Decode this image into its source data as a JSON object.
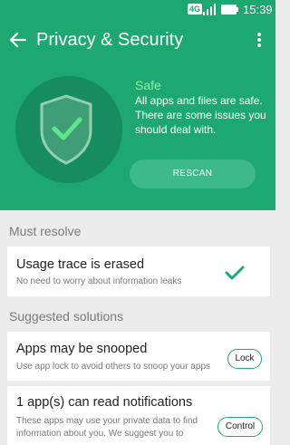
{
  "status_bar": {
    "network": "4G",
    "time": "15:39"
  },
  "app_bar": {
    "title": "Privacy & Security"
  },
  "status": {
    "label": "Safe",
    "description": "All apps and files are safe. There are some issues you should deal with."
  },
  "rescan_label": "RESCAN",
  "must_resolve": {
    "title": "Must resolve",
    "items": [
      {
        "title": "Usage trace is erased",
        "description": "No need to worry about information leaks"
      }
    ]
  },
  "suggested": {
    "title": "Suggested solutions",
    "items": [
      {
        "title": "Apps may be snooped",
        "description": "Use app lock to avoid others to snoop your apps",
        "action": "Lock"
      },
      {
        "title": "1 app(s) can read notifications",
        "description": "These apps may use your private data to find information about you. We suggest you to",
        "action": "Control"
      }
    ]
  },
  "colors": {
    "accent": "#1da771",
    "accent_dark": "#178c5e",
    "button": "#3db98a",
    "safe_label": "#8bf0a5",
    "background": "#ececec"
  }
}
